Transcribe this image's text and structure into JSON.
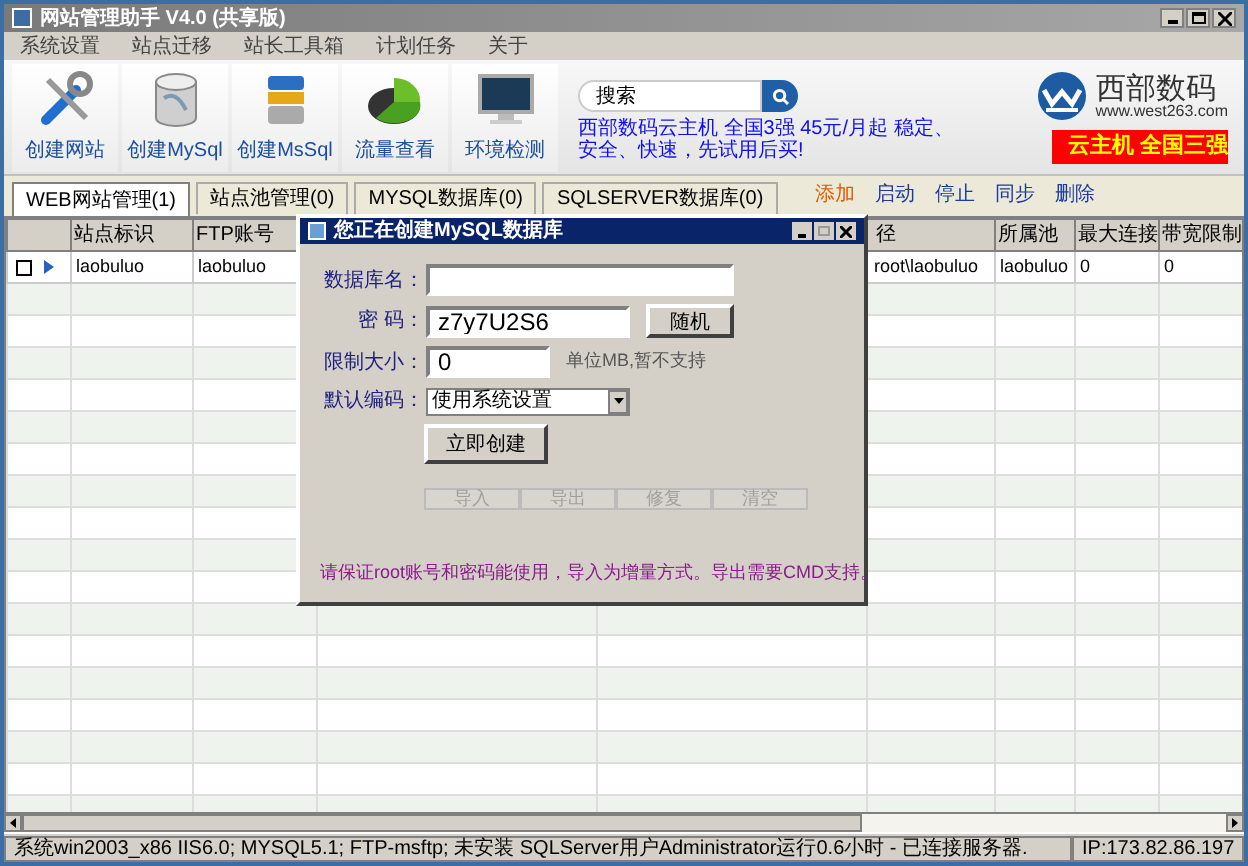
{
  "window": {
    "title": "网站管理助手 V4.0 (共享版)"
  },
  "menu": [
    "系统设置",
    "站点迁移",
    "站长工具箱",
    "计划任务",
    "关于"
  ],
  "toolbar": [
    {
      "kind": "tools",
      "label": "创建网站"
    },
    {
      "kind": "mysql",
      "label": "创建MySql"
    },
    {
      "kind": "mssql",
      "label": "创建MsSql"
    },
    {
      "kind": "pie",
      "label": "流量查看"
    },
    {
      "kind": "monitor",
      "label": "环境检测"
    }
  ],
  "search": {
    "placeholder": "搜索"
  },
  "logo": {
    "name": "西部数码",
    "url": "www.west263.com"
  },
  "ad_link": "西部数码云主机 全国3强 45元/月起 稳定、安全、快速，先试用后买!",
  "ad_banner": "云主机 全国三强",
  "tabs": [
    {
      "label": "WEB网站管理(1)",
      "selected": true
    },
    {
      "label": "站点池管理(0)",
      "selected": false
    },
    {
      "label": "MYSQL数据库(0)",
      "selected": false
    },
    {
      "label": "SQLSERVER数据库(0)",
      "selected": false
    }
  ],
  "actions": [
    {
      "label": "添加",
      "kind": "primary"
    },
    {
      "label": "启动",
      "kind": "normal"
    },
    {
      "label": "停止",
      "kind": "normal"
    },
    {
      "label": "同步",
      "kind": "normal"
    },
    {
      "label": "删除",
      "kind": "normal"
    }
  ],
  "table": {
    "columns": [
      "站点标识",
      "FTP账号",
      "径",
      "所属池",
      "最大连接",
      "带宽限制"
    ],
    "rows": [
      {
        "checked": false,
        "current": true,
        "cells": [
          "laobuluo",
          "laobuluo",
          "root\\laobuluo",
          "laobuluo",
          "0",
          "0"
        ]
      }
    ]
  },
  "dialog": {
    "title": "您正在创建MySQL数据库",
    "fields": [
      {
        "kind": "text",
        "label": "数据库名："
      },
      {
        "kind": "random",
        "label": "密 码：",
        "value": "z7y7U2S6",
        "button": "随机"
      },
      {
        "kind": "unit",
        "label": "限制大小：",
        "value": "0",
        "note": "单位MB,暂不支持"
      },
      {
        "kind": "select",
        "label": "默认编码：",
        "value": "使用系统设置"
      }
    ],
    "create_button": "立即创建",
    "tools": [
      {
        "label": "导入",
        "disabled": true
      },
      {
        "label": "导出",
        "disabled": true
      },
      {
        "label": "修复",
        "disabled": true
      },
      {
        "label": "清空",
        "disabled": true
      }
    ],
    "note": "请保证root账号和密码能使用，导入为增量方式。导出需要CMD支持。"
  },
  "status_bar": {
    "info": "系统win2003_x86 IIS6.0; MYSQL5.1; FTP-msftp; 未安装 SQLServer用户Administrator运行0.6小时 - 已连接服务器.",
    "ip": "IP:173.82.86.197"
  }
}
